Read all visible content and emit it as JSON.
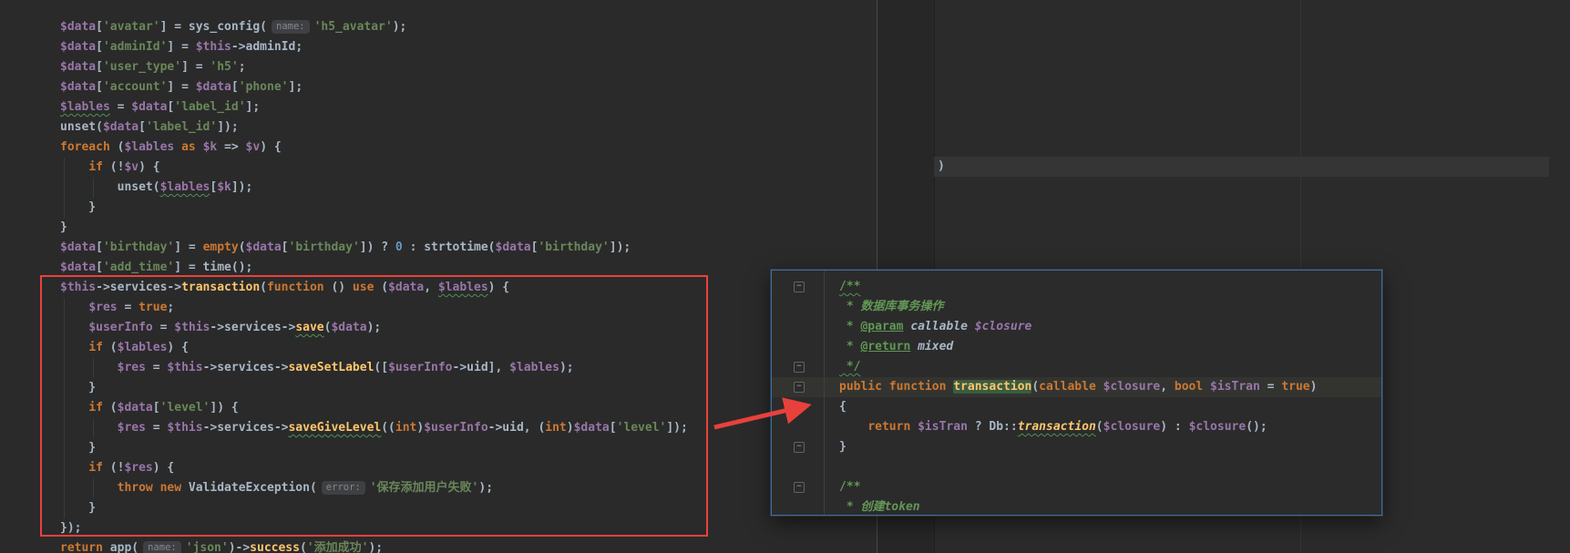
{
  "window": {
    "app": "JetBrains IDE editor (Darcula theme)"
  },
  "colors": {
    "red_annotation": "#e8413c",
    "popup_border": "#3f6e9e",
    "editor_background": "#2a2a2a",
    "keyword": "#cc7832",
    "variable": "#9876aa",
    "string": "#6a8759",
    "method": "#ffc66d",
    "comment": "#629755"
  },
  "editor": {
    "main": {
      "lines": [
        {
          "segs": [
            [
              "v",
              "$data"
            ],
            [
              "d",
              "["
            ],
            [
              "s",
              "'avatar'"
            ],
            [
              "d",
              "] = sys_config("
            ],
            [
              "h",
              "name:"
            ],
            [
              "s",
              "'h5_avatar'"
            ],
            [
              "d",
              ");"
            ]
          ]
        },
        {
          "segs": [
            [
              "v",
              "$data"
            ],
            [
              "d",
              "["
            ],
            [
              "s",
              "'adminId'"
            ],
            [
              "d",
              "] = "
            ],
            [
              "v",
              "$this"
            ],
            [
              "d",
              "->adminId;"
            ]
          ]
        },
        {
          "segs": [
            [
              "v",
              "$data"
            ],
            [
              "d",
              "["
            ],
            [
              "s",
              "'user_type'"
            ],
            [
              "d",
              "] = "
            ],
            [
              "s",
              "'h5'"
            ],
            [
              "d",
              ";"
            ]
          ]
        },
        {
          "segs": [
            [
              "v",
              "$data"
            ],
            [
              "d",
              "["
            ],
            [
              "s",
              "'account'"
            ],
            [
              "d",
              "] = "
            ],
            [
              "v",
              "$data"
            ],
            [
              "d",
              "["
            ],
            [
              "s",
              "'phone'"
            ],
            [
              "d",
              "];"
            ]
          ]
        },
        {
          "segs": [
            [
              "v w",
              "$lables"
            ],
            [
              "d",
              " = "
            ],
            [
              "v",
              "$data"
            ],
            [
              "d",
              "["
            ],
            [
              "s",
              "'label_id'"
            ],
            [
              "d",
              "];"
            ]
          ]
        },
        {
          "segs": [
            [
              "d",
              "unset("
            ],
            [
              "v",
              "$data"
            ],
            [
              "d",
              "["
            ],
            [
              "s",
              "'label_id'"
            ],
            [
              "d",
              "]);"
            ]
          ]
        },
        {
          "segs": [
            [
              "k",
              "foreach "
            ],
            [
              "d",
              "("
            ],
            [
              "v",
              "$lables"
            ],
            [
              "k",
              " as "
            ],
            [
              "v",
              "$k"
            ],
            [
              "d",
              " => "
            ],
            [
              "v",
              "$v"
            ],
            [
              "d",
              ") {"
            ]
          ]
        },
        {
          "segs": [
            [
              "d",
              "    "
            ],
            [
              "k",
              "if "
            ],
            [
              "d",
              "(!"
            ],
            [
              "v",
              "$v"
            ],
            [
              "d",
              ") {"
            ]
          ]
        },
        {
          "segs": [
            [
              "d",
              "        unset("
            ],
            [
              "v w",
              "$lables"
            ],
            [
              "d",
              "["
            ],
            [
              "v",
              "$k"
            ],
            [
              "d",
              "]);"
            ]
          ]
        },
        {
          "segs": [
            [
              "d",
              "    }"
            ]
          ]
        },
        {
          "segs": [
            [
              "d",
              "}"
            ]
          ]
        },
        {
          "segs": [
            [
              "v",
              "$data"
            ],
            [
              "d",
              "["
            ],
            [
              "s",
              "'birthday'"
            ],
            [
              "d",
              "] = "
            ],
            [
              "k",
              "empty"
            ],
            [
              "d",
              "("
            ],
            [
              "v",
              "$data"
            ],
            [
              "d",
              "["
            ],
            [
              "s",
              "'birthday'"
            ],
            [
              "d",
              "]) ? "
            ],
            [
              "n",
              "0"
            ],
            [
              "d",
              " : strtotime("
            ],
            [
              "v",
              "$data"
            ],
            [
              "d",
              "["
            ],
            [
              "s",
              "'birthday'"
            ],
            [
              "d",
              "]);"
            ]
          ]
        },
        {
          "segs": [
            [
              "v",
              "$data"
            ],
            [
              "d",
              "["
            ],
            [
              "s",
              "'add_time'"
            ],
            [
              "d",
              "] = time();"
            ]
          ]
        },
        {
          "segs": [
            [
              "v",
              "$this"
            ],
            [
              "d",
              "->services->"
            ],
            [
              "f",
              "transaction"
            ],
            [
              "d",
              "("
            ],
            [
              "k",
              "function "
            ],
            [
              "d",
              "() "
            ],
            [
              "k",
              "use "
            ],
            [
              "d",
              "("
            ],
            [
              "v",
              "$data"
            ],
            [
              "d",
              ", "
            ],
            [
              "v w",
              "$lables"
            ],
            [
              "d",
              ") {"
            ]
          ]
        },
        {
          "segs": [
            [
              "d",
              "    "
            ],
            [
              "v",
              "$res"
            ],
            [
              "d",
              " = "
            ],
            [
              "k",
              "true"
            ],
            [
              "d",
              ";"
            ]
          ]
        },
        {
          "segs": [
            [
              "d",
              "    "
            ],
            [
              "v",
              "$userInfo"
            ],
            [
              "d",
              " = "
            ],
            [
              "v",
              "$this"
            ],
            [
              "d",
              "->services->"
            ],
            [
              "f w",
              "save"
            ],
            [
              "d",
              "("
            ],
            [
              "v",
              "$data"
            ],
            [
              "d",
              ");"
            ]
          ]
        },
        {
          "segs": [
            [
              "d",
              "    "
            ],
            [
              "k",
              "if "
            ],
            [
              "d",
              "("
            ],
            [
              "v",
              "$lables"
            ],
            [
              "d",
              ") {"
            ]
          ]
        },
        {
          "segs": [
            [
              "d",
              "        "
            ],
            [
              "v",
              "$res"
            ],
            [
              "d",
              " = "
            ],
            [
              "v",
              "$this"
            ],
            [
              "d",
              "->services->"
            ],
            [
              "f",
              "saveSetLabel"
            ],
            [
              "d",
              "(["
            ],
            [
              "v",
              "$userInfo"
            ],
            [
              "d",
              "->uid], "
            ],
            [
              "v",
              "$lables"
            ],
            [
              "d",
              ");"
            ]
          ]
        },
        {
          "segs": [
            [
              "d",
              "    }"
            ]
          ]
        },
        {
          "segs": [
            [
              "d",
              "    "
            ],
            [
              "k",
              "if "
            ],
            [
              "d",
              "("
            ],
            [
              "v",
              "$data"
            ],
            [
              "d",
              "["
            ],
            [
              "s",
              "'level'"
            ],
            [
              "d",
              "]) {"
            ]
          ]
        },
        {
          "segs": [
            [
              "d",
              "        "
            ],
            [
              "v",
              "$res"
            ],
            [
              "d",
              " = "
            ],
            [
              "v",
              "$this"
            ],
            [
              "d",
              "->services->"
            ],
            [
              "f w",
              "saveGiveLevel"
            ],
            [
              "d",
              "(("
            ],
            [
              "k",
              "int"
            ],
            [
              "d",
              ")"
            ],
            [
              "v",
              "$userInfo"
            ],
            [
              "d",
              "->uid, ("
            ],
            [
              "k",
              "int"
            ],
            [
              "d",
              ")"
            ],
            [
              "v",
              "$data"
            ],
            [
              "d",
              "["
            ],
            [
              "s",
              "'level'"
            ],
            [
              "d",
              "]);"
            ]
          ]
        },
        {
          "segs": [
            [
              "d",
              "    }"
            ]
          ]
        },
        {
          "segs": [
            [
              "d",
              "    "
            ],
            [
              "k",
              "if "
            ],
            [
              "d",
              "(!"
            ],
            [
              "v",
              "$res"
            ],
            [
              "d",
              ") {"
            ]
          ]
        },
        {
          "segs": [
            [
              "d",
              "        "
            ],
            [
              "k",
              "throw new "
            ],
            [
              "d",
              "ValidateException("
            ],
            [
              "h",
              "error:"
            ],
            [
              "s",
              "'保存添加用户失败'"
            ],
            [
              "d",
              ");"
            ]
          ]
        },
        {
          "segs": [
            [
              "d",
              "    }"
            ]
          ]
        },
        {
          "segs": [
            [
              "d",
              "});"
            ]
          ]
        },
        {
          "segs": [
            [
              "k",
              "return "
            ],
            [
              "d",
              "app("
            ],
            [
              "h",
              "name:"
            ],
            [
              "s",
              "'json'"
            ],
            [
              "d",
              ")->"
            ],
            [
              "f",
              "success"
            ],
            [
              "d",
              "("
            ],
            [
              "s",
              "'添加成功'"
            ],
            [
              "d",
              ");"
            ]
          ]
        }
      ]
    },
    "right_pane": {
      "visible_text": ")"
    },
    "popup": {
      "fold_rows": [
        0,
        4,
        5,
        8,
        10
      ],
      "lines": [
        {
          "segs": [
            [
              "c w",
              "/**"
            ]
          ]
        },
        {
          "segs": [
            [
              "c",
              " * "
            ],
            [
              "ci",
              "数据库事务操作"
            ]
          ]
        },
        {
          "segs": [
            [
              "c",
              " * "
            ],
            [
              "ct",
              "@param"
            ],
            [
              "dt",
              " callable "
            ],
            [
              "dv",
              "$closure"
            ]
          ]
        },
        {
          "segs": [
            [
              "c",
              " * "
            ],
            [
              "ct",
              "@return"
            ],
            [
              "dt",
              " mixed"
            ]
          ]
        },
        {
          "segs": [
            [
              "c w",
              " */"
            ]
          ]
        },
        {
          "hl": true,
          "segs": [
            [
              "k",
              "public function "
            ],
            [
              "fh",
              "transaction"
            ],
            [
              "d",
              "("
            ],
            [
              "k",
              "callable "
            ],
            [
              "v",
              "$closure"
            ],
            [
              "d",
              ", "
            ],
            [
              "k",
              "bool "
            ],
            [
              "v",
              "$isTran"
            ],
            [
              "d",
              " = "
            ],
            [
              "k",
              "true"
            ],
            [
              "d",
              ")"
            ]
          ]
        },
        {
          "segs": [
            [
              "d",
              "{"
            ]
          ]
        },
        {
          "segs": [
            [
              "d",
              "    "
            ],
            [
              "k",
              "return "
            ],
            [
              "v",
              "$isTran"
            ],
            [
              "d",
              " ? Db::"
            ],
            [
              "f i w",
              "transaction"
            ],
            [
              "d",
              "("
            ],
            [
              "v",
              "$closure"
            ],
            [
              "d",
              ") : "
            ],
            [
              "v",
              "$closure"
            ],
            [
              "d",
              "();"
            ]
          ]
        },
        {
          "segs": [
            [
              "d",
              "}"
            ]
          ]
        },
        {
          "segs": []
        },
        {
          "segs": [
            [
              "c",
              "/**"
            ]
          ]
        },
        {
          "segs": [
            [
              "c",
              " * "
            ],
            [
              "ci",
              "创建token"
            ]
          ]
        }
      ]
    }
  },
  "annotations": {
    "fold_icon_glyph": "−"
  }
}
